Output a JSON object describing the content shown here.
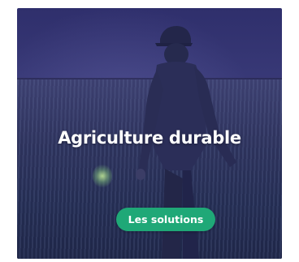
{
  "card": {
    "title": "Agriculture durable",
    "button_label": "Les solutions",
    "image_icon": "farmer-in-wheat-field-photo"
  },
  "colors": {
    "overlay": "#3a3b79",
    "button": "#1fa877",
    "text": "#ffffff"
  }
}
